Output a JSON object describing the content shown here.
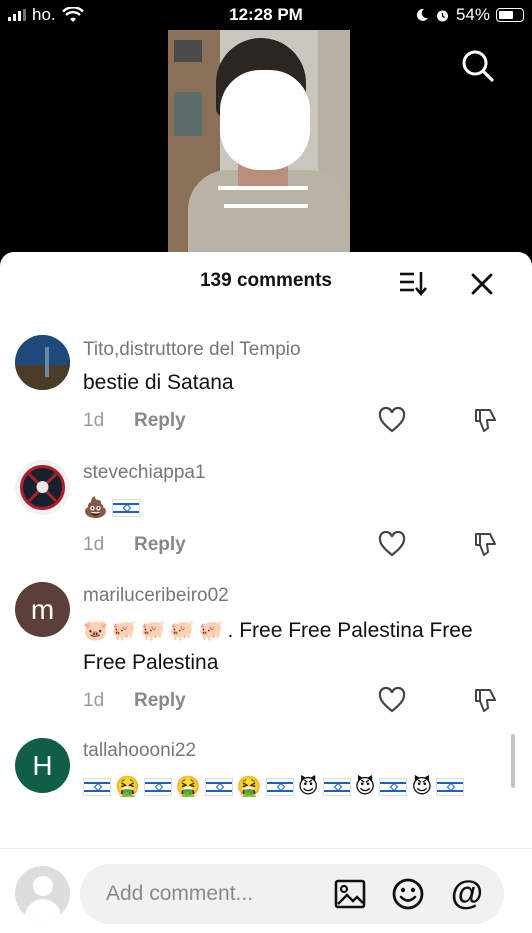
{
  "status_bar": {
    "carrier": "ho.",
    "time": "12:28 PM",
    "battery": "54%"
  },
  "sheet": {
    "title": "139 comments"
  },
  "comments": [
    {
      "username": "Tito,distruttore del Tempio",
      "text": "bestie di Satana",
      "age": "1d",
      "reply_label": "Reply",
      "avatar_letter": ""
    },
    {
      "username": "stevechiappa1",
      "text": "",
      "age": "1d",
      "reply_label": "Reply",
      "avatar_letter": ""
    },
    {
      "username": "mariluceribeiro02",
      "text": ". Free Free Palestina Free Free Palestina",
      "age": "1d",
      "reply_label": "Reply",
      "avatar_letter": "m"
    },
    {
      "username": "tallahoooni22",
      "text": "",
      "age": "",
      "reply_label": "",
      "avatar_letter": "H"
    }
  ],
  "composer": {
    "placeholder": "Add comment...",
    "at_symbol": "@"
  },
  "colors": {
    "avatar_m": "#5b3f38",
    "avatar_h": "#0f5e47"
  },
  "icons": [
    "search-icon",
    "sort-icon",
    "close-icon",
    "heart-icon",
    "thumbs-down-icon",
    "image-icon",
    "emoji-icon",
    "at-icon"
  ]
}
